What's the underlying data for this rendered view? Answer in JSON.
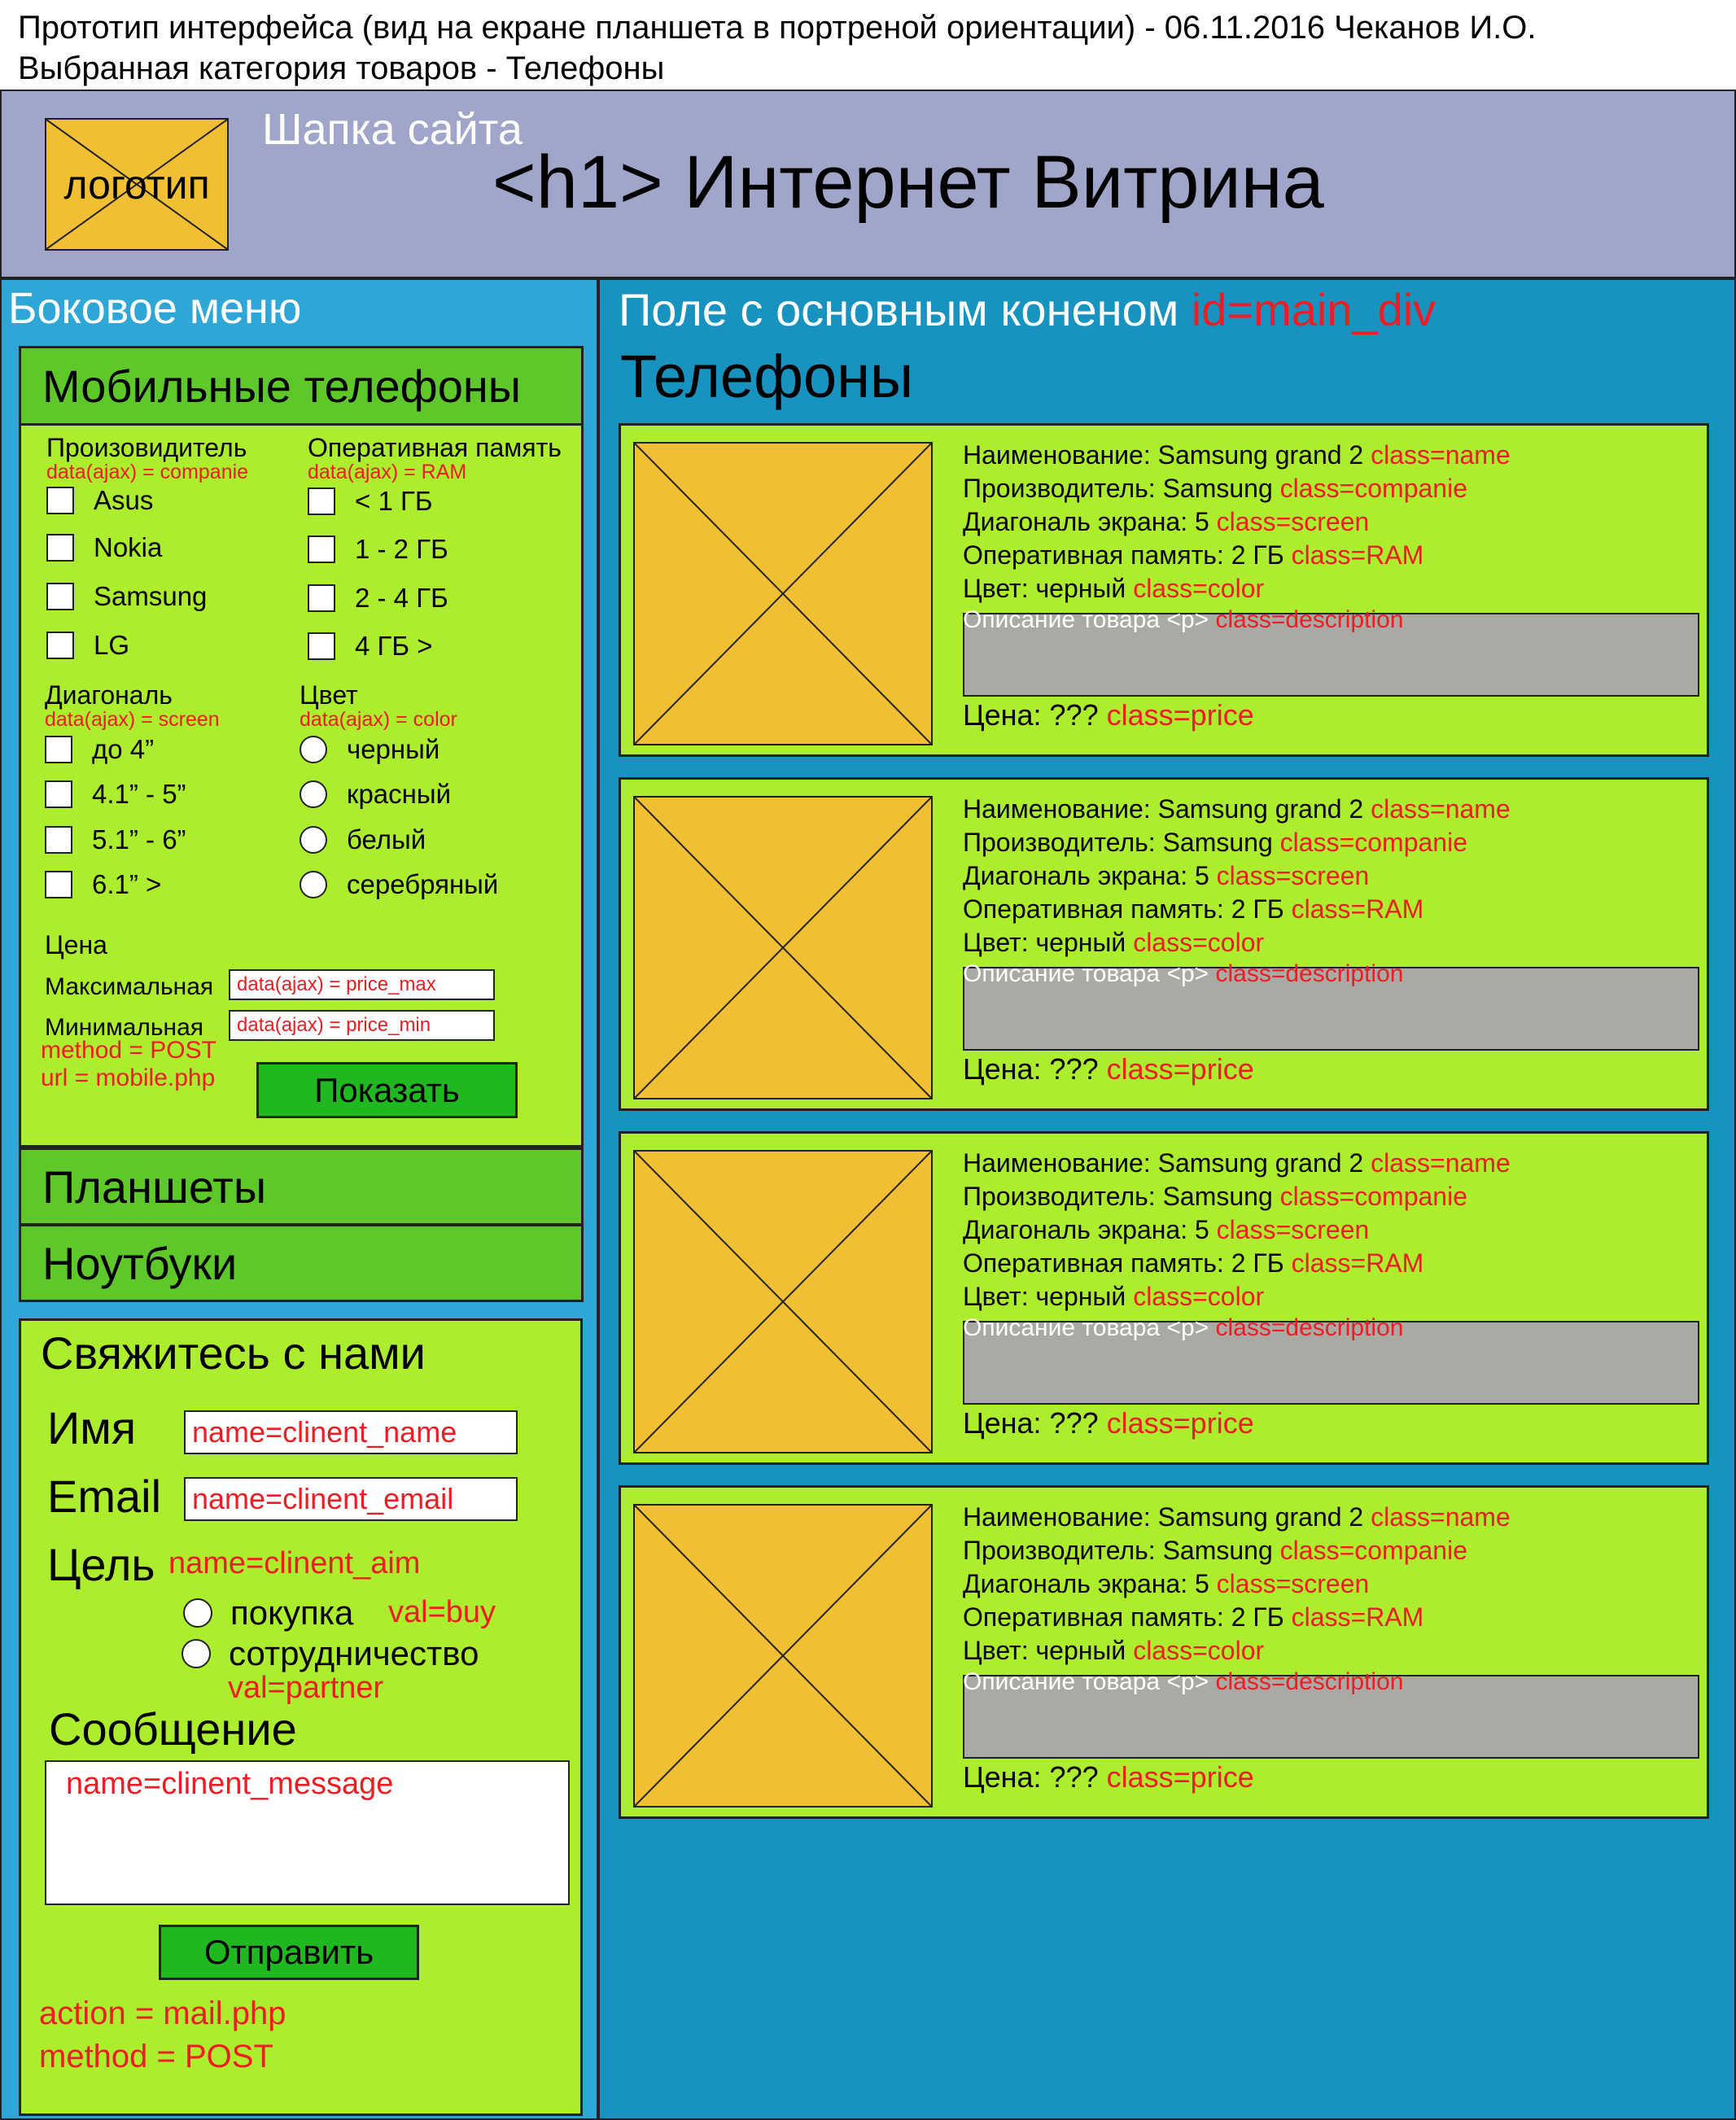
{
  "caption": {
    "line1": "Прототип интерфейса (вид на екране планшета в портреной ориентации) - 06.11.2016 Чеканов И.О.",
    "line2": "Выбранная категория товаров - Телефоны"
  },
  "header": {
    "caption": "Шапка сайта",
    "logo": "логотип",
    "title": "<h1> Интернет Витрина"
  },
  "sidebar": {
    "caption": "Боковое меню",
    "categories": [
      "Мобильные телефоны",
      "Планшеты",
      "Ноутбуки"
    ],
    "filters": {
      "manufacturer": {
        "title": "Произовидитель",
        "note": "data(ajax) = companie",
        "options": [
          "Asus",
          "Nokia",
          "Samsung",
          "LG"
        ]
      },
      "ram": {
        "title": "Оперативная память",
        "note": "data(ajax) = RAM",
        "options": [
          "< 1 ГБ",
          "1 - 2 ГБ",
          "2 - 4 ГБ",
          "4 ГБ >"
        ]
      },
      "diagonal": {
        "title": "Диагональ",
        "note": "data(ajax) = screen",
        "options": [
          "до 4”",
          "4.1” - 5”",
          "5.1” - 6”",
          "6.1” >"
        ]
      },
      "color": {
        "title": "Цвет",
        "note": "data(ajax) = color",
        "options": [
          "черный",
          "красный",
          "белый",
          "серебряный"
        ]
      },
      "price": {
        "title": "Цена",
        "max_label": "Максимальная",
        "max_value": "data(ajax) = price_max",
        "min_label": "Минимальная",
        "min_value": "data(ajax) = price_min"
      },
      "method": "method = POST",
      "url": "url = mobile.php",
      "submit": "Показать"
    }
  },
  "contact": {
    "title": "Свяжитесь с нами",
    "name_label": "Имя",
    "name_value": "name=clinent_name",
    "email_label": "Email",
    "email_value": "name=clinent_email",
    "aim_label": "Цель",
    "aim_name": "name=clinent_aim",
    "aim_options": [
      {
        "label": "покупка",
        "val": "val=buy"
      },
      {
        "label": "сотрудничество",
        "val": "val=partner"
      }
    ],
    "message_label": "Сообщение",
    "message_value": "name=clinent_message",
    "submit": "Отправить",
    "action": "action = mail.php",
    "method": "method = POST"
  },
  "main": {
    "caption": "Поле с основным коненом",
    "caption_id": "id=main_div",
    "title": "Телефоны",
    "products": [
      {
        "name_label": "Наименование: Samsung grand 2",
        "name_class": "class=name",
        "companie_label": "Производитель: Samsung",
        "companie_class": "class=companie",
        "screen_label": "Диагональ экрана: 5",
        "screen_class": "class=screen",
        "ram_label": "Оперативная память: 2 ГБ",
        "ram_class": "class=RAM",
        "color_label": "Цвет: черный",
        "color_class": "class=color",
        "desc_label": "Описание товара <p>",
        "desc_class": "class=description",
        "price_label": "Цена: ???",
        "price_class": "class=price"
      },
      {
        "name_label": "Наименование: Samsung grand 2",
        "name_class": "class=name",
        "companie_label": "Производитель: Samsung",
        "companie_class": "class=companie",
        "screen_label": "Диагональ экрана: 5",
        "screen_class": "class=screen",
        "ram_label": "Оперативная память: 2 ГБ",
        "ram_class": "class=RAM",
        "color_label": "Цвет: черный",
        "color_class": "class=color",
        "desc_label": "Описание товара <p>",
        "desc_class": "class=description",
        "price_label": "Цена: ???",
        "price_class": "class=price"
      },
      {
        "name_label": "Наименование: Samsung grand 2",
        "name_class": "class=name",
        "companie_label": "Производитель: Samsung",
        "companie_class": "class=companie",
        "screen_label": "Диагональ экрана: 5",
        "screen_class": "class=screen",
        "ram_label": "Оперативная память: 2 ГБ",
        "ram_class": "class=RAM",
        "color_label": "Цвет: черный",
        "color_class": "class=color",
        "desc_label": "Описание товара <p>",
        "desc_class": "class=description",
        "price_label": "Цена: ???",
        "price_class": "class=price"
      },
      {
        "name_label": "Наименование: Samsung grand 2",
        "name_class": "class=name",
        "companie_label": "Производитель: Samsung",
        "companie_class": "class=companie",
        "screen_label": "Диагональ экрана: 5",
        "screen_class": "class=screen",
        "ram_label": "Оперативная память: 2 ГБ",
        "ram_class": "class=RAM",
        "color_label": "Цвет: черный",
        "color_class": "class=color",
        "desc_label": "Описание товара <p>",
        "desc_class": "class=description",
        "price_label": "Цена: ???",
        "price_class": "class=price"
      }
    ]
  },
  "colors": {
    "header_bg": "#a0a6c9",
    "sidebar_bg": "#2ea7d7",
    "main_bg": "#1893bf",
    "panel_bg": "#aced2e",
    "accordion_bg": "#5ec82a",
    "button_bg": "#1fb820",
    "image_placeholder": "#f1bf34",
    "description_bg": "#aaa9a4",
    "annotation": "#ee1c23"
  },
  "icons": [
    "image-placeholder-icon",
    "checkbox-icon",
    "radio-icon"
  ]
}
